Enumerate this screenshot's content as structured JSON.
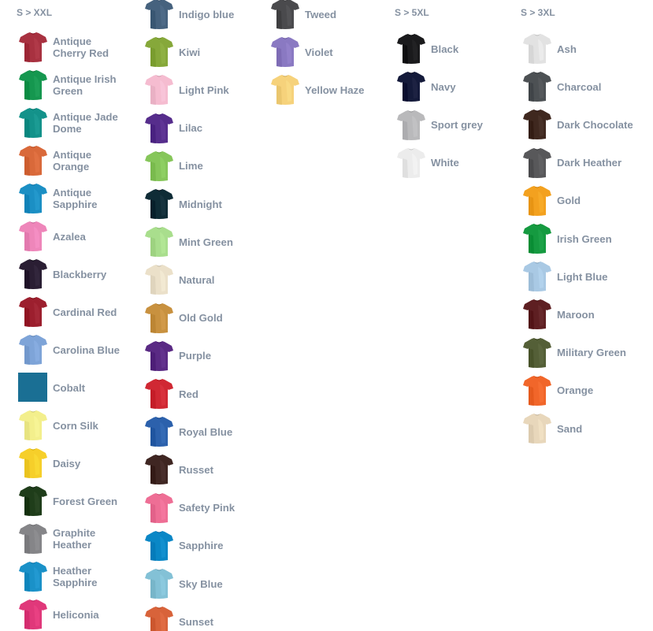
{
  "columns": [
    {
      "heading": "S > XXL",
      "items": [
        {
          "label": "Antique Cherry Red",
          "color": "#a83140",
          "icon": "tshirt-icon"
        },
        {
          "label": "Antique Irish Green",
          "color": "#15974f",
          "icon": "tshirt-icon"
        },
        {
          "label": "Antique Jade Dome",
          "color": "#13928a",
          "icon": "tshirt-icon"
        },
        {
          "label": "Antique Orange",
          "color": "#d9693a",
          "icon": "tshirt-icon"
        },
        {
          "label": "Antique Sapphire",
          "color": "#1b8fc4",
          "icon": "tshirt-icon"
        },
        {
          "label": "Azalea",
          "color": "#ee86ba",
          "icon": "tshirt-icon"
        },
        {
          "label": "Blackberry",
          "color": "#2a1e33",
          "icon": "tshirt-icon"
        },
        {
          "label": "Cardinal Red",
          "color": "#9c1f2e",
          "icon": "tshirt-icon"
        },
        {
          "label": "Carolina Blue",
          "color": "#7ea4d8",
          "icon": "tshirt-icon"
        },
        {
          "label": "Cobalt",
          "color": "#1a6f94",
          "icon": "square-swatch"
        },
        {
          "label": "Corn Silk",
          "color": "#f3ef8c",
          "icon": "tshirt-icon"
        },
        {
          "label": "Daisy",
          "color": "#f6cf2a",
          "icon": "tshirt-icon"
        },
        {
          "label": "Forest Green",
          "color": "#1f3d1a",
          "icon": "tshirt-icon"
        },
        {
          "label": "Graphite Heather",
          "color": "#858588",
          "icon": "tshirt-icon"
        },
        {
          "label": "Heather Sapphire",
          "color": "#1a91c8",
          "icon": "tshirt-icon"
        },
        {
          "label": "Heliconia",
          "color": "#e0387a",
          "icon": "tshirt-icon"
        }
      ]
    },
    {
      "heading": "",
      "items": [
        {
          "label": "Indigo blue",
          "color": "#46627e",
          "icon": "tshirt-icon"
        },
        {
          "label": "Kiwi",
          "color": "#86a83a",
          "icon": "tshirt-icon"
        },
        {
          "label": "Light Pink",
          "color": "#f5bcd0",
          "icon": "tshirt-icon"
        },
        {
          "label": "Lilac",
          "color": "#562d8c",
          "icon": "tshirt-icon"
        },
        {
          "label": "Lime",
          "color": "#86c65a",
          "icon": "tshirt-icon"
        },
        {
          "label": "Midnight",
          "color": "#0f2c36",
          "icon": "tshirt-icon"
        },
        {
          "label": "Mint Green",
          "color": "#a9de8d",
          "icon": "tshirt-icon"
        },
        {
          "label": "Natural",
          "color": "#ebe0c9",
          "icon": "tshirt-icon"
        },
        {
          "label": "Old Gold",
          "color": "#c8913f",
          "icon": "tshirt-icon"
        },
        {
          "label": "Purple",
          "color": "#5a2a84",
          "icon": "tshirt-icon"
        },
        {
          "label": "Red",
          "color": "#d02833",
          "icon": "tshirt-icon"
        },
        {
          "label": "Royal Blue",
          "color": "#2c61ac",
          "icon": "tshirt-icon"
        },
        {
          "label": "Russet",
          "color": "#3f2622",
          "icon": "tshirt-icon"
        },
        {
          "label": "Safety Pink",
          "color": "#ee6e95",
          "icon": "tshirt-icon"
        },
        {
          "label": "Sapphire",
          "color": "#0a87c6",
          "icon": "tshirt-icon"
        },
        {
          "label": "Sky Blue",
          "color": "#83c1d6",
          "icon": "tshirt-icon"
        },
        {
          "label": "Sunset",
          "color": "#d8633a",
          "icon": "tshirt-icon"
        }
      ]
    },
    {
      "heading": "",
      "items": [
        {
          "label": "Tweed",
          "color": "#4a4a4d",
          "icon": "tshirt-icon"
        },
        {
          "label": "Violet",
          "color": "#8a79c2",
          "icon": "tshirt-icon"
        },
        {
          "label": "Yellow Haze",
          "color": "#f6d27b",
          "icon": "tshirt-icon"
        }
      ]
    },
    {
      "heading": "S > 5XL",
      "items": [
        {
          "label": "Black",
          "color": "#1a1a1c",
          "icon": "tshirt-icon"
        },
        {
          "label": "Navy",
          "color": "#141a3a",
          "icon": "tshirt-icon"
        },
        {
          "label": "Sport grey",
          "color": "#b9b9bb",
          "icon": "tshirt-icon"
        },
        {
          "label": "White",
          "color": "#ececec",
          "icon": "tshirt-icon"
        }
      ]
    },
    {
      "heading": "S > 3XL",
      "items": [
        {
          "label": "Ash",
          "color": "#e2e2e2",
          "icon": "tshirt-icon"
        },
        {
          "label": "Charcoal",
          "color": "#4d5154",
          "icon": "tshirt-icon"
        },
        {
          "label": "Dark Chocolate",
          "color": "#3f281f",
          "icon": "tshirt-icon"
        },
        {
          "label": "Dark Heather",
          "color": "#58585a",
          "icon": "tshirt-icon"
        },
        {
          "label": "Gold",
          "color": "#f3a11f",
          "icon": "tshirt-icon"
        },
        {
          "label": "Irish Green",
          "color": "#159a40",
          "icon": "tshirt-icon"
        },
        {
          "label": "Light Blue",
          "color": "#a9c9e4",
          "icon": "tshirt-icon"
        },
        {
          "label": "Maroon",
          "color": "#5e1f22",
          "icon": "tshirt-icon"
        },
        {
          "label": "Military Green",
          "color": "#545f37",
          "icon": "tshirt-icon"
        },
        {
          "label": "Orange",
          "color": "#f1662a",
          "icon": "tshirt-icon"
        },
        {
          "label": "Sand",
          "color": "#e8d7bb",
          "icon": "tshirt-icon"
        }
      ]
    }
  ]
}
